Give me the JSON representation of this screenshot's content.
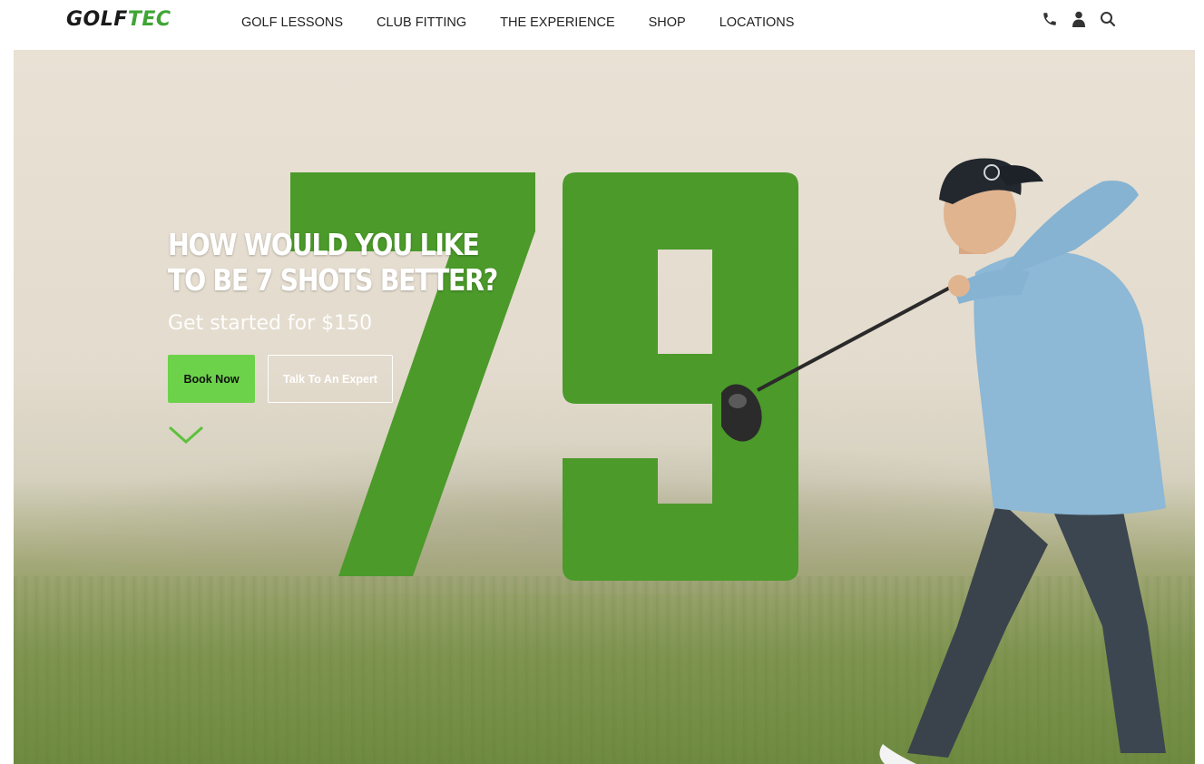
{
  "brand": {
    "logo_part_a": "GOLF",
    "logo_part_b": "TEC",
    "accent_color": "#3fa535",
    "button_color": "#6cd24a",
    "number_color": "#4b9a2a"
  },
  "nav": {
    "items": [
      {
        "label": "GOLF LESSONS"
      },
      {
        "label": "CLUB FITTING"
      },
      {
        "label": "THE EXPERIENCE"
      },
      {
        "label": "SHOP"
      },
      {
        "label": "LOCATIONS"
      }
    ]
  },
  "utility": {
    "icons": [
      "phone-icon",
      "user-icon",
      "search-icon"
    ]
  },
  "hero": {
    "headline_line1": "HOW WOULD YOU LIKE",
    "headline_line2": "TO BE 7 SHOTS BETTER?",
    "subhead": "Get started for $150",
    "book_label": "Book Now",
    "expert_label": "Talk To An Expert",
    "big_number": "79"
  }
}
